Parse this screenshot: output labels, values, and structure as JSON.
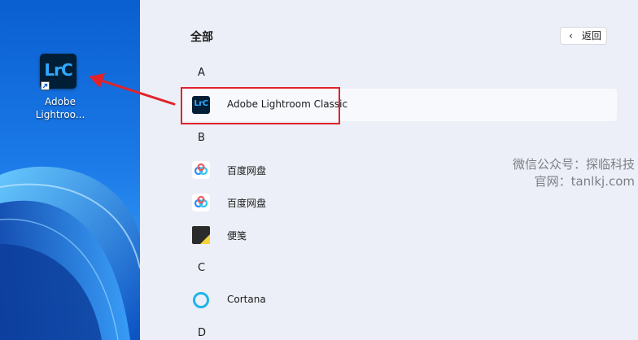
{
  "desktop": {
    "shortcut_icon_text": "LrC",
    "shortcut_label": "Adobe\nLightroo...",
    "icon_name": "lightroom-classic-icon"
  },
  "start_menu": {
    "title": "全部",
    "back_button": {
      "chevron": "‹",
      "label": "返回"
    },
    "groups": [
      {
        "letter": "A",
        "apps": [
          {
            "label": "Adobe Lightroom Classic",
            "icon": "lightroom-classic-icon",
            "icon_text": "LrC",
            "highlighted": true
          }
        ]
      },
      {
        "letter": "B",
        "apps": [
          {
            "label": "百度网盘",
            "icon": "baidu-netdisk-icon"
          },
          {
            "label": "百度网盘",
            "icon": "baidu-netdisk-icon"
          },
          {
            "label": "便笺",
            "icon": "sticky-notes-icon"
          }
        ]
      },
      {
        "letter": "C",
        "apps": [
          {
            "label": "Cortana",
            "icon": "cortana-icon"
          }
        ]
      },
      {
        "letter": "D",
        "apps": []
      }
    ]
  },
  "watermark": {
    "line1": "微信公众号：探临科技",
    "line2": "官网：tanlkj.com"
  },
  "colors": {
    "annotation_red": "#e0232b",
    "lrc_bg": "#001e36",
    "lrc_text": "#31a8ff",
    "panel_bg": "#eceff7"
  }
}
